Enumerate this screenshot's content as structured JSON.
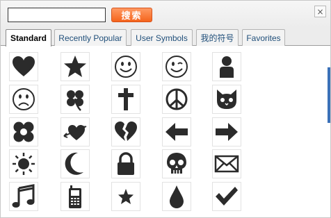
{
  "search": {
    "value": "",
    "button_label": "搜索"
  },
  "close": {
    "label": "×"
  },
  "tabs": [
    {
      "label": "Standard",
      "active": true
    },
    {
      "label": "Recently Popular",
      "active": false
    },
    {
      "label": "User Symbols",
      "active": false
    },
    {
      "label": "我的符号",
      "active": false
    },
    {
      "label": "Favorites",
      "active": false
    }
  ],
  "symbols": [
    [
      "heart",
      "star",
      "smiley",
      "wink",
      "person"
    ],
    [
      "frown",
      "clover",
      "cross",
      "peace",
      "cat"
    ],
    [
      "flower",
      "heart-arrow",
      "broken-heart",
      "arrow-left",
      "arrow-right"
    ],
    [
      "sun",
      "moon",
      "lock",
      "skull",
      "envelope"
    ],
    [
      "music-note",
      "cellphone",
      "small-star",
      "drop",
      "checkmark"
    ]
  ],
  "colors": {
    "icon_fill": "#2b2b2b",
    "search_button": "#f5641c",
    "active_tab_text": "#000000",
    "tab_text": "#1f4e79"
  }
}
